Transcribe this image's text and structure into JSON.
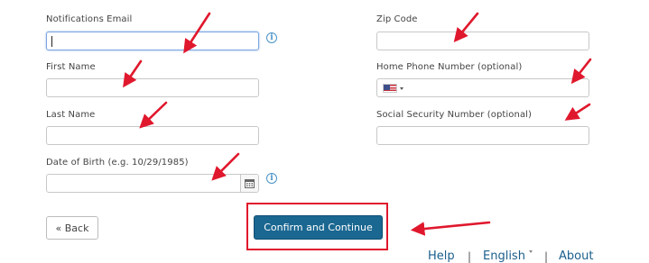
{
  "form": {
    "notifications_email": {
      "label": "Notifications Email",
      "value": ""
    },
    "first_name": {
      "label": "First Name",
      "value": ""
    },
    "last_name": {
      "label": "Last Name",
      "value": ""
    },
    "date_of_birth": {
      "label": "Date of Birth (e.g. 10/29/1985)",
      "value": ""
    },
    "zip_code": {
      "label": "Zip Code",
      "value": ""
    },
    "home_phone": {
      "label": "Home Phone Number (optional)",
      "value": "",
      "country": "United States"
    },
    "ssn": {
      "label": "Social Security Number (optional)",
      "value": ""
    },
    "info_icon": "i"
  },
  "buttons": {
    "back": "« Back",
    "confirm": "Confirm and Continue"
  },
  "footer": {
    "help": "Help",
    "language": "English",
    "about": "About",
    "separator": "|"
  },
  "annotations": {
    "arrow_color": "#e0182d",
    "highlight_color": "#e0182d"
  },
  "colors": {
    "primary_button": "#1a6791",
    "link": "#1a5e8c",
    "info": "#4a93c8"
  }
}
